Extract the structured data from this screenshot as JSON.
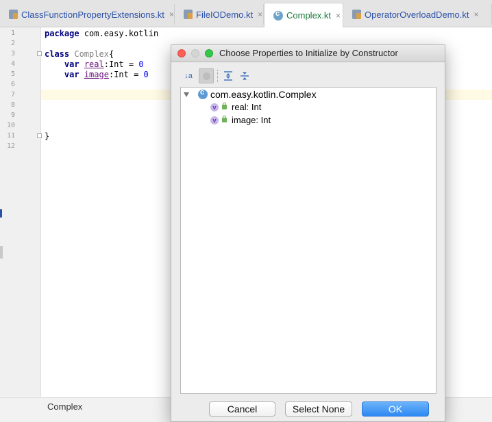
{
  "tabs": [
    {
      "label": "ClassFunctionPropertyExtensions.kt",
      "icon": "kotlin-file-icon",
      "active": false
    },
    {
      "label": "FileIODemo.kt",
      "icon": "kotlin-file-icon",
      "active": false
    },
    {
      "label": "Complex.kt",
      "icon": "kotlin-class-icon",
      "active": true
    },
    {
      "label": "OperatorOverloadDemo.kt",
      "icon": "kotlin-file-icon",
      "active": false
    }
  ],
  "tab_close_glyph": "×",
  "editor": {
    "line_numbers": [
      "1",
      "2",
      "3",
      "4",
      "5",
      "6",
      "7",
      "8",
      "9",
      "10",
      "11",
      "12"
    ],
    "code": {
      "kw_package": "package",
      "package_name": "com.easy.kotlin",
      "kw_class": "class",
      "class_name": "Complex",
      "brace_open": "{",
      "kw_var": "var",
      "prop_real": "real",
      "prop_image": "image",
      "type_suffix": ":Int = ",
      "zero": "0",
      "brace_close": "}"
    }
  },
  "statusbar": {
    "breadcrumb": "Complex"
  },
  "dialog": {
    "title": "Choose Properties to Initialize by Constructor",
    "toolbar": {
      "sort_label": "↓a"
    },
    "tree": {
      "root": "com.easy.kotlin.Complex",
      "children": [
        "real: Int",
        "image: Int"
      ]
    },
    "buttons": {
      "cancel": "Cancel",
      "select_none": "Select None",
      "ok": "OK"
    }
  }
}
